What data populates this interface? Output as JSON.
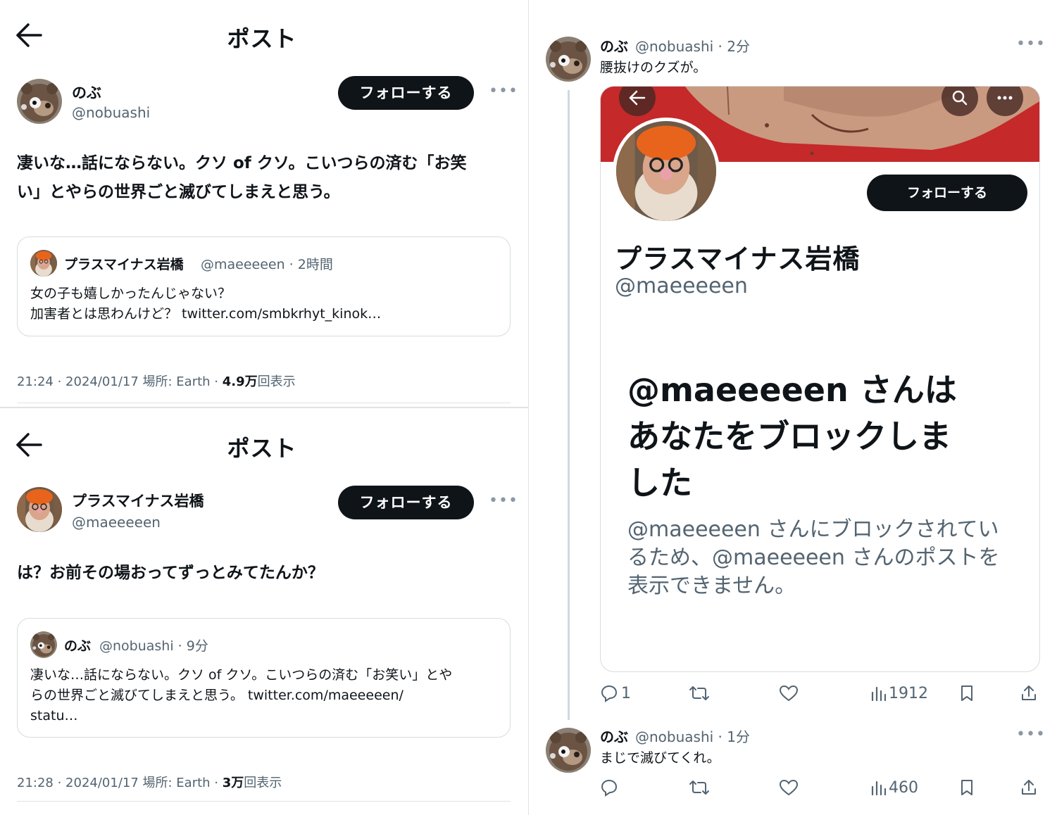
{
  "left_panel": {
    "post1": {
      "header_title": "ポスト",
      "author": {
        "name": "のぶ",
        "handle": "@nobuashi"
      },
      "follow_label": "フォローする",
      "text_lines": [
        "凄いな…話にならない。クソ of クソ。こいつらの済む「お笑",
        "い」とやらの世界ごと滅びてしまえと思う。"
      ],
      "quote": {
        "name": "プラスマイナス岩橋",
        "handle_time": "@maeeeeen · 2時間",
        "lines": [
          "女の子も嬉しかったんじゃない？",
          "加害者とは思わんけど？ twitter.com/smbkrhyt_kinok…"
        ]
      },
      "meta": {
        "prefix": "21:24 · 2024/01/17 場所: Earth · ",
        "views": "4.9万",
        "suffix": "回表示"
      }
    },
    "post2": {
      "header_title": "ポスト",
      "author": {
        "name": "プラスマイナス岩橋",
        "handle": "@maeeeeen"
      },
      "follow_label": "フォローする",
      "text_lines": [
        "は？お前その場おってずっとみてたんか？"
      ],
      "quote": {
        "name": "のぶ",
        "handle_time": "@nobuashi · 9分",
        "lines": [
          "凄いな…話にならない。クソ of クソ。こいつらの済む「お笑い」とや",
          "らの世界ごと滅びてしまえと思う。 twitter.com/maeeeeen/",
          "statu…"
        ]
      },
      "meta": {
        "prefix": "21:28 · 2024/01/17 場所: Earth · ",
        "views": "3万",
        "suffix": "回表示"
      }
    }
  },
  "right_panel": {
    "tweet1": {
      "name": "のぶ",
      "handle_time": "@nobuashi · 2分",
      "text": "腰抜けのクズが。",
      "embed": {
        "follow_label": "フォローする",
        "profile_name": "プラスマイナス岩橋",
        "profile_handle": "@maeeeeen",
        "blocked_title_lines": [
          "@maeeeeen さんは",
          "あなたをブロックしま",
          "した"
        ],
        "blocked_body_lines": [
          "@maeeeeen さんにブロックされてい",
          "るため、@maeeeeen さんのポストを",
          "表示できません。"
        ]
      },
      "actions": {
        "replies": "1",
        "views": "1912"
      }
    },
    "tweet2": {
      "name": "のぶ",
      "handle_time": "@nobuashi · 1分",
      "text": "まじで滅びてくれ。",
      "actions": {
        "replies": "",
        "views": "460"
      }
    }
  },
  "icons": [
    "back-arrow-icon",
    "more-icon",
    "reply-icon",
    "retweet-icon",
    "like-icon",
    "views-icon",
    "bookmark-icon",
    "share-icon",
    "search-icon"
  ],
  "colors": {
    "text": "#0f1419",
    "secondary": "#536471",
    "button": "#0f1419",
    "border": "#d6dce0",
    "banner": "#c5292a"
  }
}
